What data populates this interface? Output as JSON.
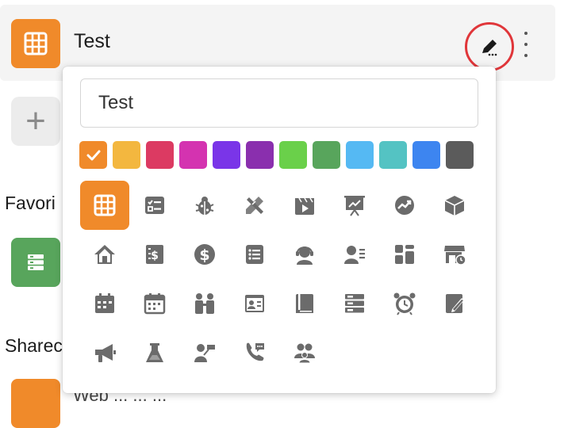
{
  "header": {
    "title": "Test",
    "app_icon": "grid-icon",
    "edit_icon": "pencil-icon",
    "more_icon": "vertical-dots-icon"
  },
  "sidebar": {
    "add_icon": "plus-icon",
    "favorites_label": "Favori",
    "shared_label": "Sharec",
    "bottom_item_label": "Web ... ... ..."
  },
  "popup": {
    "name_value": "Test",
    "selected_color_index": 0,
    "colors": [
      "#f08a2a",
      "#f3b73f",
      "#dc3a62",
      "#d433b0",
      "#7a35e8",
      "#8a2fae",
      "#6ad04a",
      "#58a55c",
      "#55b9f3",
      "#54c3c3",
      "#3d85f0",
      "#5b5b5b"
    ],
    "selected_icon_index": 0,
    "icons": [
      "grid-icon",
      "checklist-icon",
      "bug-icon",
      "tools-icon",
      "video-icon",
      "presentation-icon",
      "trend-icon",
      "box-icon",
      "home-icon",
      "receipt-icon",
      "dollar-icon",
      "list-icon",
      "support-agent-icon",
      "contact-list-icon",
      "dashboard-icon",
      "store-icon",
      "calendar-check-icon",
      "calendar-icon",
      "people-icon",
      "id-card-icon",
      "book-icon",
      "server-icon",
      "alarm-clock-icon",
      "notebook-icon",
      "megaphone-icon",
      "lab-flask-icon",
      "presenter-icon",
      "phone-chat-icon",
      "group-icon"
    ]
  }
}
